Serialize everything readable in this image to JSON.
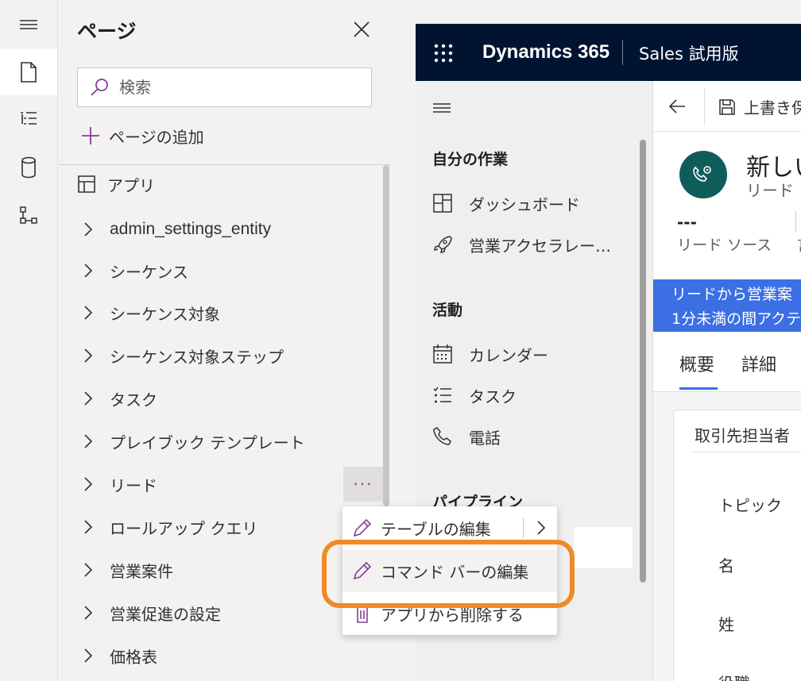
{
  "rail": {
    "items": [
      "hamburger-icon",
      "page-icon",
      "tree-icon",
      "database-icon",
      "flow-icon"
    ],
    "active": "page-icon"
  },
  "pages": {
    "title": "ページ",
    "search_placeholder": "検索",
    "add_page_label": "ページの追加",
    "root_label": "アプリ",
    "items": [
      {
        "label": "admin_settings_entity"
      },
      {
        "label": "シーケンス"
      },
      {
        "label": "シーケンス対象"
      },
      {
        "label": "シーケンス対象ステップ"
      },
      {
        "label": "タスク"
      },
      {
        "label": "プレイブック テンプレート"
      },
      {
        "label": "リード"
      },
      {
        "label": "ロールアップ クエリ"
      },
      {
        "label": "営業案件"
      },
      {
        "label": "営業促進の設定"
      },
      {
        "label": "価格表"
      }
    ],
    "more_label": "···"
  },
  "context_menu": {
    "items": [
      {
        "label": "テーブルの編集",
        "icon": "pencil-icon",
        "has_submenu": true
      },
      {
        "label": "コマンド バーの編集",
        "icon": "pencil-icon",
        "highlighted": true
      },
      {
        "label": "アプリから削除する",
        "icon": "trash-icon"
      }
    ],
    "highlight_color": "#f08a24"
  },
  "preview": {
    "app_title": "Dynamics 365",
    "app_subtitle": "Sales 試用版",
    "sitemap": {
      "groups": [
        {
          "label": "自分の作業",
          "items": [
            {
              "label": "ダッシュボード",
              "icon": "dashboard-icon"
            },
            {
              "label": "営業アクセラレー…",
              "icon": "rocket-icon"
            }
          ]
        },
        {
          "label": "活動",
          "items": [
            {
              "label": "カレンダー",
              "icon": "calendar-icon"
            },
            {
              "label": "タスク",
              "icon": "task-list-icon"
            },
            {
              "label": "電話",
              "icon": "phone-icon"
            }
          ]
        },
        {
          "label": "パイプライン",
          "items": []
        }
      ]
    },
    "form": {
      "save_label": "上書き保",
      "record_title": "新しい",
      "record_type": "リード",
      "header_value": "---",
      "header_label": "リード ソース",
      "header_label2_cut": "言",
      "banner_lines": [
        "リードから営業案",
        "1分未満の間アクテ"
      ],
      "tabs": [
        "概要",
        "詳細"
      ],
      "card_title": "取引先担当者",
      "fields": [
        "トピック",
        "名",
        "姓",
        "役職"
      ]
    }
  },
  "colors": {
    "topbar": "#001432",
    "accent": "#3c6fe3",
    "avatar": "#0f5d5a",
    "purple": "#8a3d97"
  }
}
